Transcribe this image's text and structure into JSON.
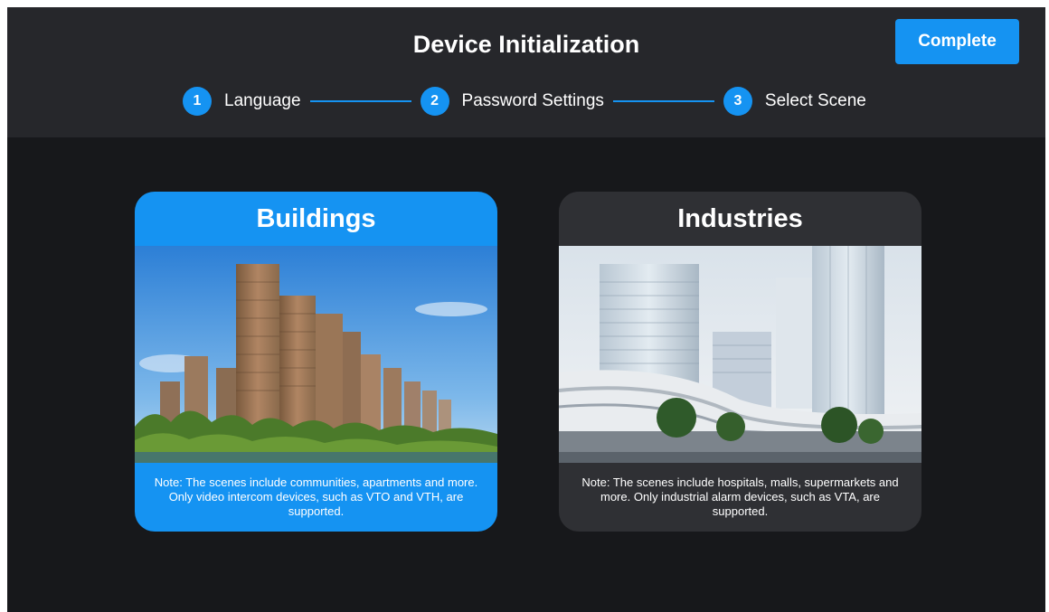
{
  "header": {
    "title": "Device Initialization",
    "complete_label": "Complete"
  },
  "steps": [
    {
      "number": "1",
      "label": "Language"
    },
    {
      "number": "2",
      "label": "Password Settings"
    },
    {
      "number": "3",
      "label": "Select Scene"
    }
  ],
  "scenes": [
    {
      "title": "Buildings",
      "note": "Note: The scenes include communities, apartments and more. Only video intercom devices, such as VTO and VTH, are supported.",
      "selected": true
    },
    {
      "title": "Industries",
      "note": "Note: The scenes include hospitals, malls, supermarkets and more. Only industrial alarm devices, such as VTA, are supported.",
      "selected": false
    }
  ],
  "colors": {
    "accent": "#1593f2",
    "background": "#17181b",
    "header": "#26272b",
    "card_unselected": "#2f3034"
  }
}
